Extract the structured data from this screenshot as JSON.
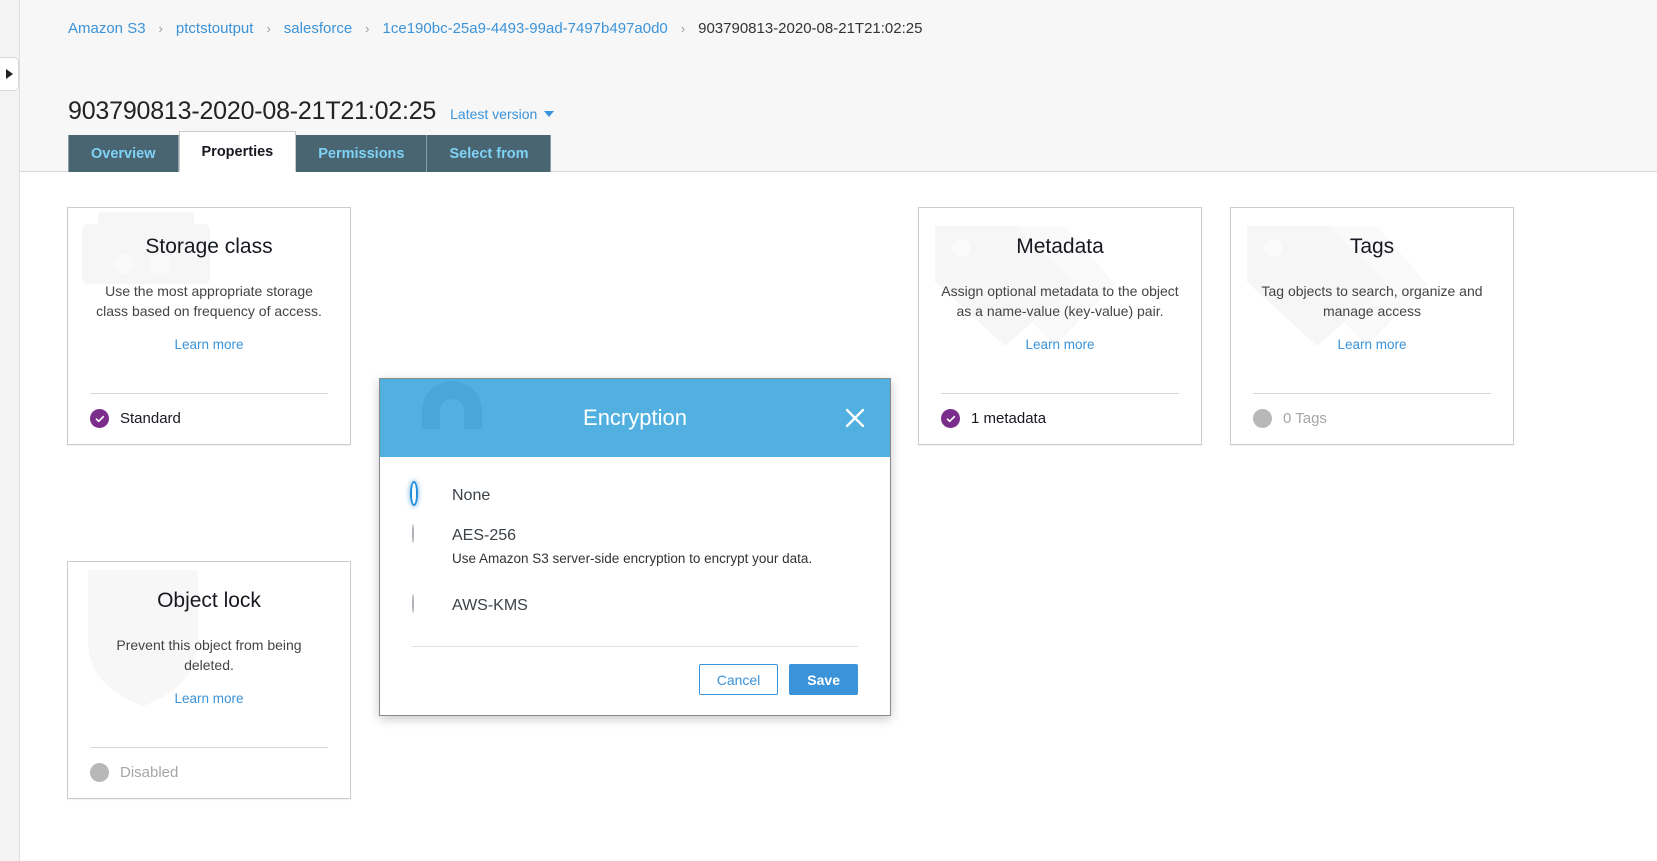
{
  "breadcrumb": {
    "items": [
      {
        "label": "Amazon S3",
        "link": true
      },
      {
        "label": "ptctstoutput",
        "link": true
      },
      {
        "label": "salesforce",
        "link": true
      },
      {
        "label": "1ce190bc-25a9-4493-99ad-7497b497a0d0",
        "link": true
      },
      {
        "label": "903790813-2020-08-21T21:02:25",
        "link": false
      }
    ],
    "separator": "›"
  },
  "page": {
    "title": "903790813-2020-08-21T21:02:25",
    "version_label": "Latest version"
  },
  "tabs": [
    {
      "label": "Overview",
      "active": false
    },
    {
      "label": "Properties",
      "active": true
    },
    {
      "label": "Permissions",
      "active": false
    },
    {
      "label": "Select from",
      "active": false
    }
  ],
  "cards": {
    "storage_class": {
      "title": "Storage class",
      "description": "Use the most appropriate storage class based on frequency of access.",
      "learn_more": "Learn more",
      "status": "Standard",
      "status_state": "on"
    },
    "metadata": {
      "title": "Metadata",
      "description": "Assign optional metadata to the object as a name-value (key-value) pair.",
      "learn_more": "Learn more",
      "status": "1 metadata",
      "status_state": "on"
    },
    "tags": {
      "title": "Tags",
      "description": "Tag objects to search, organize and manage access",
      "learn_more": "Learn more",
      "status": "0 Tags",
      "status_state": "off"
    },
    "object_lock": {
      "title": "Object lock",
      "description": "Prevent this object from being deleted.",
      "learn_more": "Learn more",
      "status": "Disabled",
      "status_state": "off"
    }
  },
  "modal": {
    "title": "Encryption",
    "close_icon": "close-icon",
    "options": [
      {
        "label": "None",
        "sub": "",
        "selected": true
      },
      {
        "label": "AES-256",
        "sub": "Use Amazon S3 server-side encryption to encrypt your data.",
        "selected": false
      },
      {
        "label": "AWS-KMS",
        "sub": "",
        "selected": false
      }
    ],
    "cancel_label": "Cancel",
    "save_label": "Save"
  },
  "colors": {
    "accent_blue": "#3b93d9",
    "modal_header": "#52b0e0",
    "tab_bar": "#4a6572",
    "tab_text": "#7fd2f5",
    "status_on": "#7b2d8b",
    "status_off": "#b8b8b8"
  }
}
